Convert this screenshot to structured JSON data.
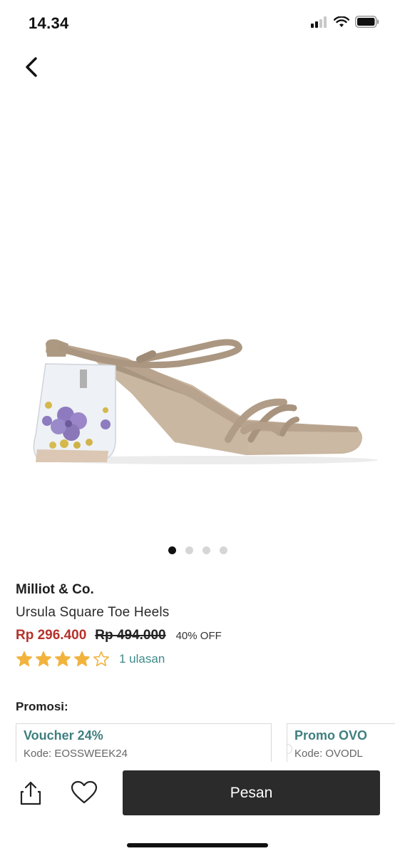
{
  "status_bar": {
    "time": "14.34"
  },
  "carousel": {
    "count": 4,
    "active": 0
  },
  "product": {
    "brand": "Milliot & Co.",
    "name": "Ursula Square Toe Heels",
    "price_current": "Rp 296.400",
    "price_original": "Rp 494.000",
    "discount": "40% OFF",
    "rating": 4,
    "rating_max": 5,
    "reviews_label": "1 ulasan"
  },
  "promo": {
    "title": "Promosi:",
    "cards": [
      {
        "name": "Voucher 24%",
        "code": "Kode: EOSSWEEK24"
      },
      {
        "name": "Promo OVO",
        "code": "Kode: OVODL"
      }
    ]
  },
  "bottom_bar": {
    "order_label": "Pesan"
  },
  "colors": {
    "price": "#b5322b",
    "accent_teal": "#3f8a8a",
    "star": "#f2b33d",
    "button_dark": "#2b2b2b"
  }
}
